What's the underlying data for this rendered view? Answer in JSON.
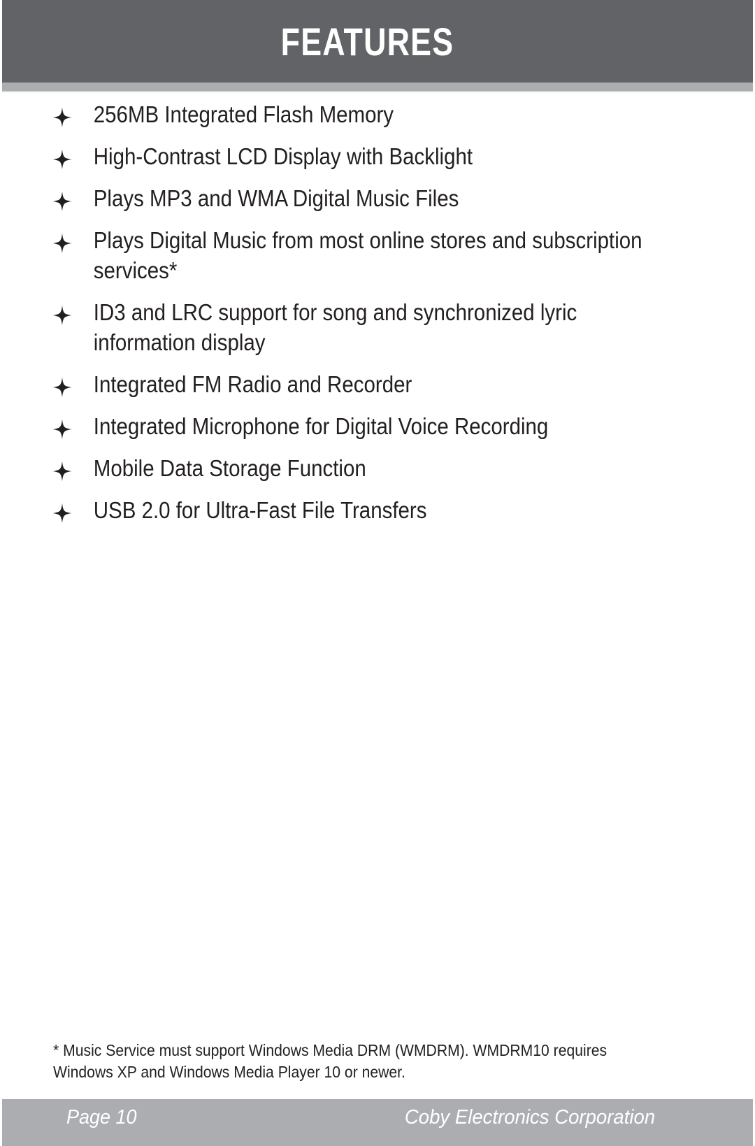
{
  "header": {
    "title": "FEATURES",
    "band_color": "#626366",
    "accent_color": "#ABADB1"
  },
  "bullet_icon": "four-pointed-star",
  "features": [
    "256MB Integrated Flash Memory",
    "High-Contrast LCD Display with Backlight",
    "Plays MP3 and WMA Digital Music Files",
    "Plays Digital Music from most online stores and subscription services*",
    "ID3 and LRC support for song and synchronized lyric information display",
    "Integrated FM Radio and Recorder",
    "Integrated Microphone for Digital Voice Recording",
    "Mobile Data Storage Function",
    "USB 2.0 for Ultra-Fast File Transfers"
  ],
  "footnote": "* Music Service must support Windows Media DRM (WMDRM). WMDRM10 requires Windows XP and Windows Media Player 10 or newer.",
  "footer": {
    "page_label": "Page 10",
    "company": "Coby Electronics Corporation",
    "band_color": "#ABADB1"
  }
}
